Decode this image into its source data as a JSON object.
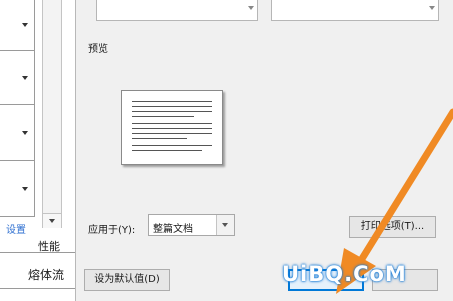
{
  "background_document": {
    "settings_link": "设置",
    "header_fragment": "性能",
    "row_fragment": "熔体流"
  },
  "dialog": {
    "preview": {
      "label": "预览"
    },
    "apply_to": {
      "label": "应用于(Y):",
      "value": "整篇文档"
    },
    "buttons": {
      "print_options": "打印选项(T)...",
      "set_default": "设为默认值(D)",
      "ok": "",
      "cancel": ""
    }
  },
  "annotation": {
    "arrow_color": "#f08a24"
  },
  "watermark": {
    "text": "UiBQ.CoM"
  }
}
